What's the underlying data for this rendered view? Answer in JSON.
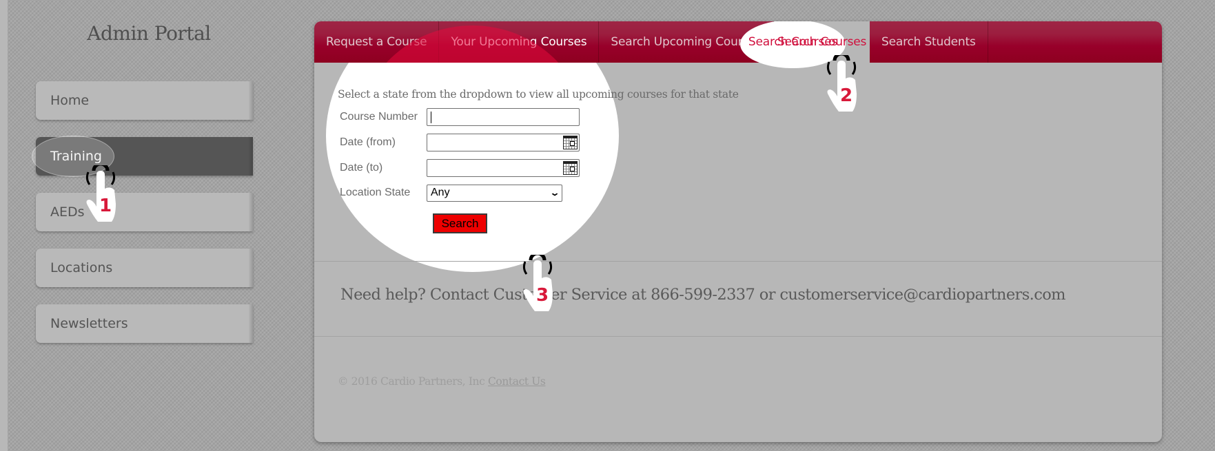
{
  "sidebar": {
    "title": "Admin Portal",
    "items": [
      {
        "label": "Home",
        "active": false
      },
      {
        "label": "Training",
        "active": true
      },
      {
        "label": "AEDs",
        "active": false
      },
      {
        "label": "Locations",
        "active": false
      },
      {
        "label": "Newsletters",
        "active": false
      }
    ]
  },
  "tabs": [
    {
      "label": "Request a Course",
      "active": false
    },
    {
      "label": "Your Upcoming Courses",
      "active": false
    },
    {
      "label": "Search Upcoming Courses",
      "active": false
    },
    {
      "label": "Search Courses",
      "active": true
    },
    {
      "label": "Search Students",
      "active": false
    }
  ],
  "form": {
    "instruction": "Select a state from the dropdown to view all upcoming courses for that state",
    "course_number": {
      "label": "Course Number",
      "value": ""
    },
    "date_from": {
      "label": "Date (from)",
      "value": "",
      "icon": "calendar-icon"
    },
    "date_to": {
      "label": "Date (to)",
      "value": "",
      "icon": "calendar-icon"
    },
    "location_state": {
      "label": "Location State",
      "selected": "Any"
    },
    "search_label": "Search"
  },
  "help": {
    "text": "Need help? Contact Customer Service at 866-599-2337 or customerservice@cardiopartners.com"
  },
  "footer": {
    "copyright": "© 2016 Cardio Partners, Inc",
    "contact_link": "Contact Us"
  },
  "annotations": [
    {
      "step": "1",
      "target": "Training"
    },
    {
      "step": "2",
      "target": "Search Courses"
    },
    {
      "step": "3",
      "target": "Search"
    }
  ],
  "colors": {
    "brand_red": "#98002a",
    "active_tab_text": "#d0103d",
    "search_button": "#ee0000",
    "active_sidebar": "#555555"
  }
}
